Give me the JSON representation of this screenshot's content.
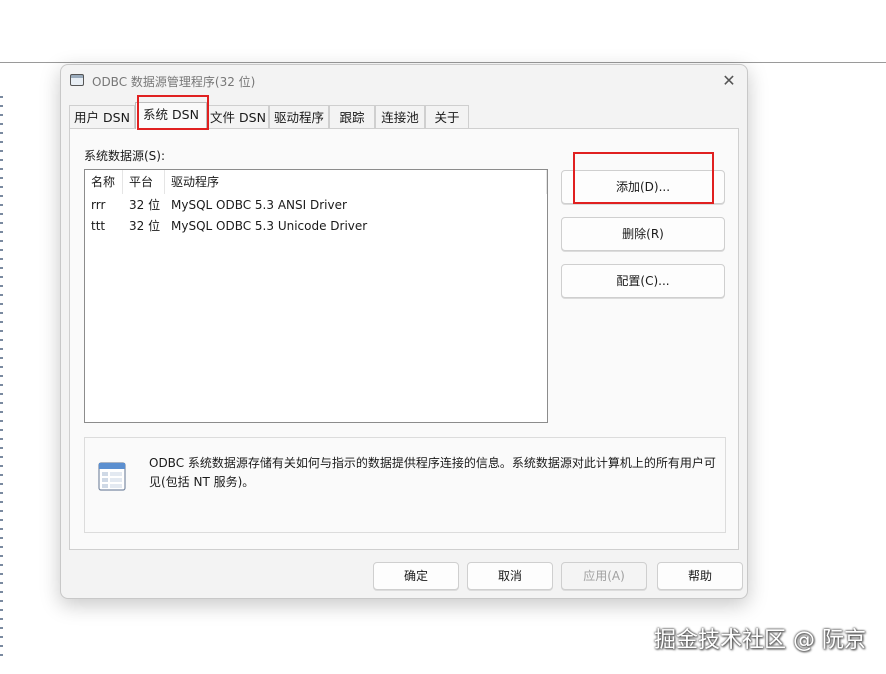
{
  "window": {
    "title": "ODBC 数据源管理程序(32 位)",
    "close_glyph": "✕"
  },
  "tabs": [
    {
      "label": "用户 DSN"
    },
    {
      "label": "系统 DSN"
    },
    {
      "label": "文件 DSN"
    },
    {
      "label": "驱动程序"
    },
    {
      "label": "跟踪"
    },
    {
      "label": "连接池"
    },
    {
      "label": "关于"
    }
  ],
  "active_tab": "系统 DSN",
  "list": {
    "label": "系统数据源(S):",
    "headers": [
      "名称",
      "平台",
      "驱动程序"
    ],
    "rows": [
      [
        "rrr",
        "32 位",
        "MySQL ODBC 5.3 ANSI Driver"
      ],
      [
        "ttt",
        "32 位",
        "MySQL ODBC 5.3 Unicode Driver"
      ]
    ]
  },
  "side_buttons": {
    "add": "添加(D)...",
    "remove": "删除(R)",
    "configure": "配置(C)..."
  },
  "description": "ODBC 系统数据源存储有关如何与指示的数据提供程序连接的信息。系统数据源对此计算机上的所有用户可见(包括 NT 服务)。",
  "footer": {
    "ok": "确定",
    "cancel": "取消",
    "apply": "应用(A)",
    "help": "帮助"
  },
  "watermark": "掘金技术社区 @ 阮京",
  "colors": {
    "highlight": "#e02020",
    "disabled_text": "#a0a0a0"
  }
}
